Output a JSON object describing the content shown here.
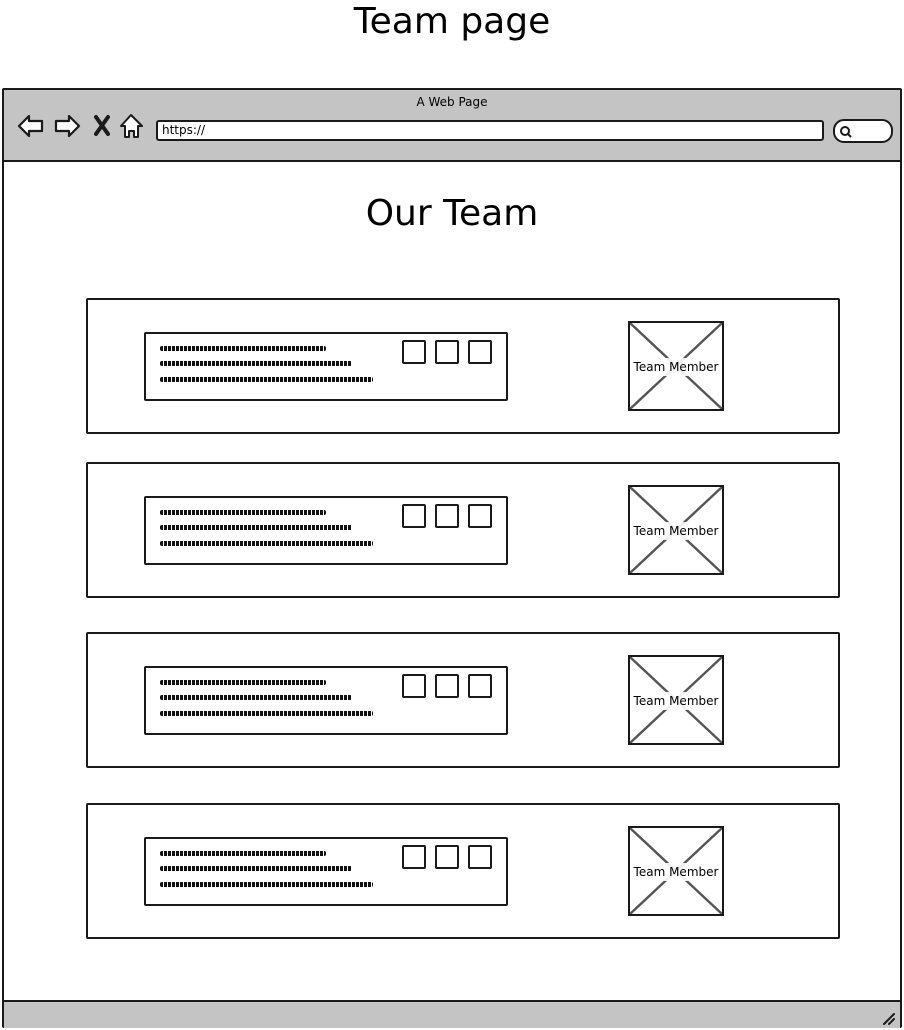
{
  "page": {
    "heading": "Team page"
  },
  "browser": {
    "window_title": "A Web Page",
    "address": "https://",
    "icons": [
      "back-arrow-icon",
      "forward-arrow-icon",
      "stop-x-icon",
      "home-icon",
      "search-icon",
      "resize-grip-icon"
    ]
  },
  "content": {
    "title": "Our Team",
    "members": [
      {
        "photo_label": "Team Member"
      },
      {
        "photo_label": "Team Member"
      },
      {
        "photo_label": "Team Member"
      },
      {
        "photo_label": "Team Member"
      }
    ]
  }
}
